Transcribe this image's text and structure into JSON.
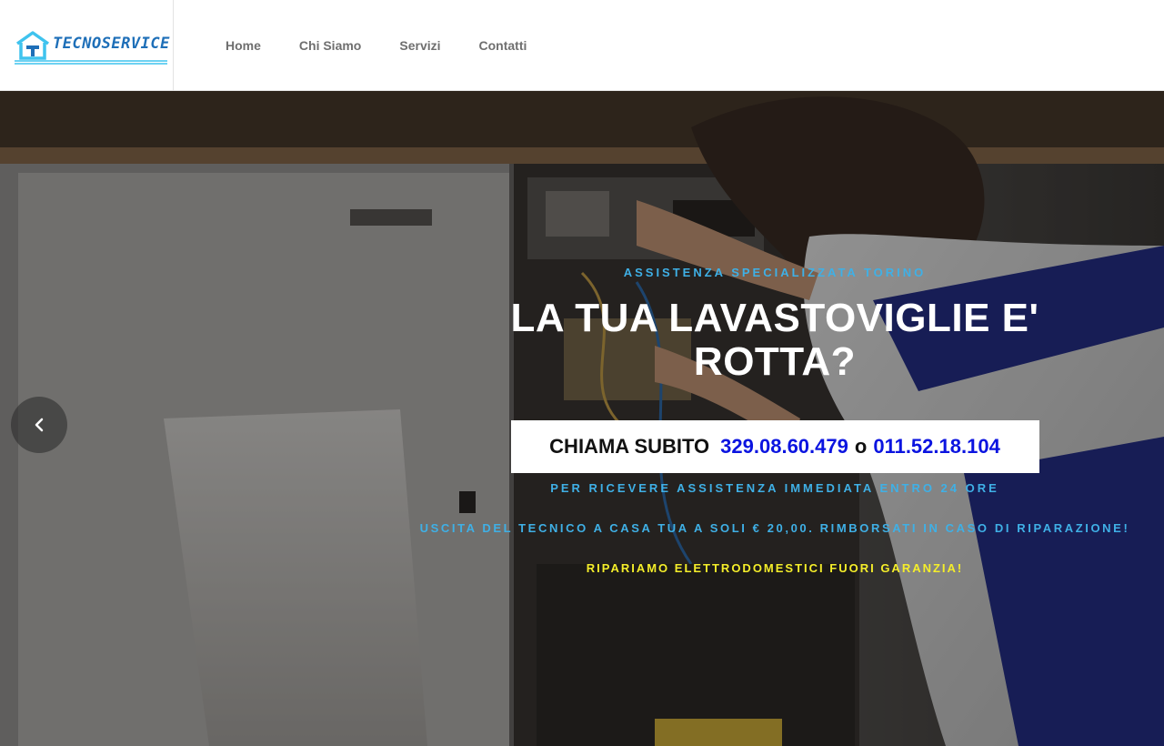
{
  "brand": {
    "name": "TECNOSERVICE",
    "color": "#1e6fb8",
    "accent": "#3fc3ee"
  },
  "nav": {
    "items": [
      {
        "label": "Home"
      },
      {
        "label": "Chi Siamo"
      },
      {
        "label": "Servizi"
      },
      {
        "label": "Contatti"
      }
    ]
  },
  "hero": {
    "kicker": "ASSISTENZA SPECIALIZZATA TORINO",
    "headline": "LA TUA LAVASTOVIGLIE E' ROTTA?",
    "cta": {
      "label": "CHIAMA SUBITO",
      "phone1": "329.08.60.479",
      "separator": "o",
      "phone2": "011.52.18.104"
    },
    "subline1": "PER RICEVERE ASSISTENZA IMMEDIATA ENTRO 24 ORE",
    "subline2": "USCITA DEL TECNICO A CASA TUA A SOLI € 20,00. RIMBORSATI IN CASO DI RIPARAZIONE!",
    "subline3": "RIPARIAMO ELETTRODOMESTICI FUORI GARANZIA!",
    "prev_icon": "chevron-left-icon"
  },
  "colors": {
    "kicker": "#3fb0e6",
    "phone": "#0b14e0",
    "highlight": "#f5ee2a"
  }
}
